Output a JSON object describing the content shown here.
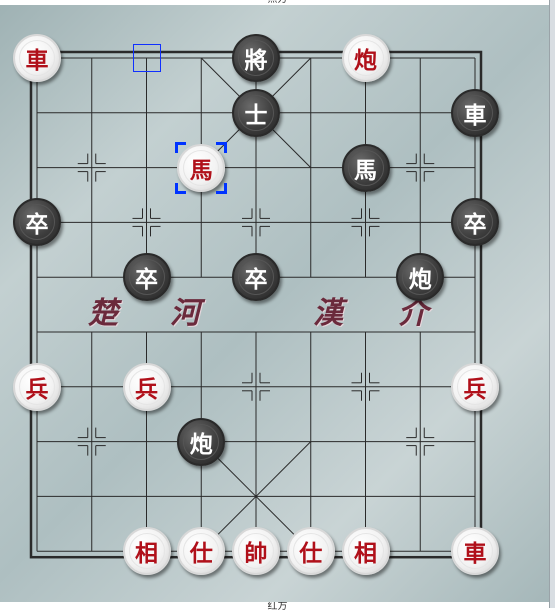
{
  "captions": {
    "top": "黑方",
    "bottom": "红方"
  },
  "river": {
    "chu": "楚",
    "he": "河",
    "han": "漢",
    "jie": "介"
  },
  "colors": {
    "red_text": "#b0101a",
    "black_piece": "#3d3d3d",
    "line": "#2a2a2a",
    "selection": "#0033ff"
  },
  "pieces": [
    {
      "side": "red",
      "char": "車",
      "file": 0,
      "rank": 0,
      "name": "red-chariot-piece"
    },
    {
      "side": "black",
      "char": "將",
      "file": 4,
      "rank": 0,
      "name": "black-general-piece"
    },
    {
      "side": "red",
      "char": "炮",
      "file": 6,
      "rank": 0,
      "name": "red-cannon-piece"
    },
    {
      "side": "black",
      "char": "士",
      "file": 4,
      "rank": 1,
      "name": "black-advisor-piece"
    },
    {
      "side": "black",
      "char": "車",
      "file": 8,
      "rank": 1,
      "name": "black-chariot-piece"
    },
    {
      "side": "red",
      "char": "馬",
      "file": 3,
      "rank": 2,
      "name": "red-horse-piece",
      "selected": true
    },
    {
      "side": "black",
      "char": "馬",
      "file": 6,
      "rank": 2,
      "name": "black-horse-piece"
    },
    {
      "side": "black",
      "char": "卒",
      "file": 0,
      "rank": 3,
      "name": "black-soldier-piece"
    },
    {
      "side": "black",
      "char": "卒",
      "file": 8,
      "rank": 3,
      "name": "black-soldier-piece"
    },
    {
      "side": "black",
      "char": "卒",
      "file": 2,
      "rank": 4,
      "name": "black-soldier-piece"
    },
    {
      "side": "black",
      "char": "卒",
      "file": 4,
      "rank": 4,
      "name": "black-soldier-piece"
    },
    {
      "side": "black",
      "char": "炮",
      "file": 7,
      "rank": 4,
      "name": "black-cannon-piece"
    },
    {
      "side": "red",
      "char": "兵",
      "file": 0,
      "rank": 6,
      "name": "red-soldier-piece"
    },
    {
      "side": "red",
      "char": "兵",
      "file": 2,
      "rank": 6,
      "name": "red-soldier-piece"
    },
    {
      "side": "red",
      "char": "兵",
      "file": 8,
      "rank": 6,
      "name": "red-soldier-piece"
    },
    {
      "side": "black",
      "char": "炮",
      "file": 3,
      "rank": 7,
      "name": "black-cannon-piece"
    },
    {
      "side": "red",
      "char": "相",
      "file": 2,
      "rank": 9,
      "name": "red-elephant-piece"
    },
    {
      "side": "red",
      "char": "仕",
      "file": 3,
      "rank": 9,
      "name": "red-advisor-piece"
    },
    {
      "side": "red",
      "char": "帥",
      "file": 4,
      "rank": 9,
      "name": "red-general-piece"
    },
    {
      "side": "red",
      "char": "仕",
      "file": 5,
      "rank": 9,
      "name": "red-advisor-piece"
    },
    {
      "side": "red",
      "char": "相",
      "file": 6,
      "rank": 9,
      "name": "red-elephant-piece"
    },
    {
      "side": "red",
      "char": "車",
      "file": 8,
      "rank": 9,
      "name": "red-chariot-piece"
    }
  ],
  "last_move_from": {
    "file": 2,
    "rank": 0
  }
}
